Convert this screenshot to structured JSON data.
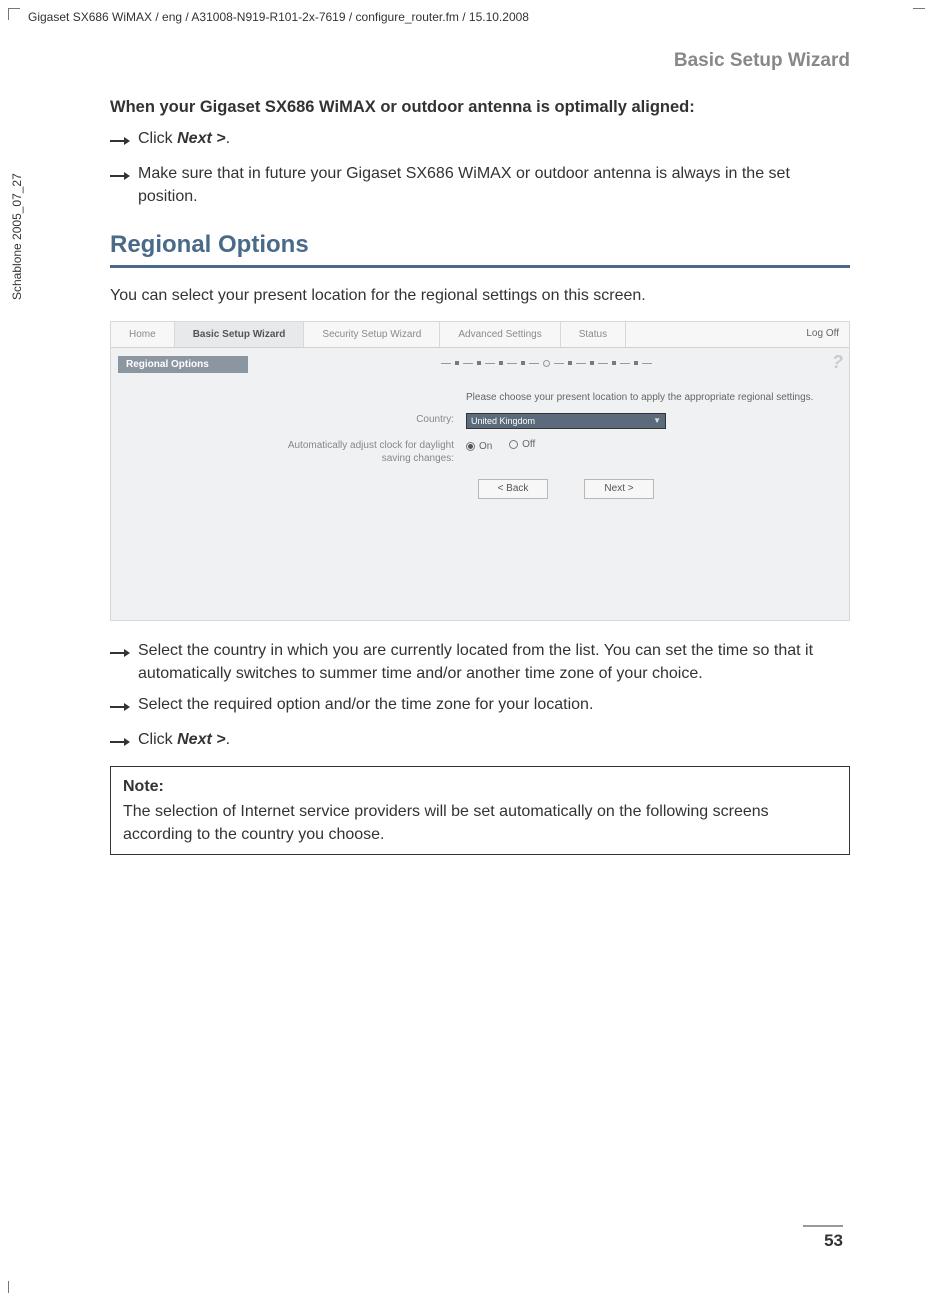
{
  "header_path": "Gigaset SX686 WiMAX / eng / A31008-N919-R101-2x-7619 / configure_router.fm / 15.10.2008",
  "side_text": "Schablone 2005_07_27",
  "section_header": "Basic Setup Wizard",
  "intro_bold": "When your Gigaset SX686 WiMAX or  outdoor antenna is optimally aligned:",
  "step1_pre": "Click ",
  "step1_em": "Next >",
  "step1_post": ".",
  "step2": "Make sure that in future your Gigaset SX686 WiMAX or  outdoor antenna is always in the set position.",
  "h2": "Regional Options",
  "body1": "You can select your present location for the regional settings on this screen.",
  "router": {
    "tabs": {
      "home": "Home",
      "basic": "Basic Setup Wizard",
      "security": "Security Setup Wizard",
      "advanced": "Advanced Settings",
      "status": "Status"
    },
    "logoff": "Log Off",
    "side": "Regional Options",
    "instruction": "Please choose your present location to apply the appropriate regional settings.",
    "country_label": "Country:",
    "country_value": "United Kingdom",
    "dst_label": "Automatically adjust clock for daylight saving changes:",
    "on": "On",
    "off": "Off",
    "back": "< Back",
    "next": "Next >",
    "help": "?"
  },
  "step3": "Select the country in which you are currently located from the list. You can set the time so that it automatically switches to summer time and/or another time zone of your choice.",
  "step4": "Select the required option and/or the time zone for your location.",
  "step5_pre": "Click ",
  "step5_em": "Next >",
  "step5_post": ".",
  "note_label": "Note:",
  "note_body": "The selection of Internet service providers will be set automatically on the following screens according to the country you choose.",
  "page_num": "53"
}
